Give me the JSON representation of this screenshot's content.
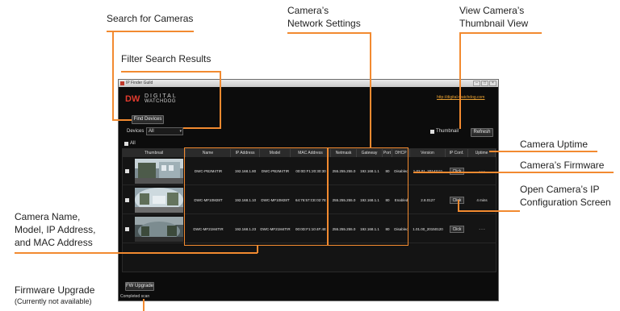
{
  "callouts": {
    "search_cameras": "Search for Cameras",
    "filter_results": "Filter Search Results",
    "network_settings_1": "Camera’s",
    "network_settings_2": "Network Settings",
    "thumbnail_view_1": "View Camera’s",
    "thumbnail_view_2": "Thumbnail View",
    "uptime": "Camera Uptime",
    "firmware": "Camera’s Firmware",
    "ip_config_1": "Open Camera’s IP",
    "ip_config_2": "Configuration Screen",
    "name_block_1": "Camera Name,",
    "name_block_2": "Model, IP Address,",
    "name_block_3": "and MAC Address",
    "fw_upgrade_1": "Firmware Upgrade",
    "fw_upgrade_2": "(Currently not available)"
  },
  "app": {
    "title": "IP Finder Guild",
    "logo_mark": "DW",
    "logo_brand": "DIGITAL",
    "logo_brand2": "WATCHDOG",
    "web_link": "http://digital-watchdog.com",
    "find_devices": "Find Devices",
    "devices_label": "Devices",
    "devices_value": "All",
    "thumbnail_label": "Thumbnail",
    "refresh": "Refresh",
    "all_label": "All",
    "fw_upgrade": "FW Upgrade",
    "status": "Completed scan"
  },
  "table": {
    "columns": [
      "Thumbnail",
      "Name",
      "IP Address",
      "Model",
      "MAC Address",
      "Netmask",
      "Gateway",
      "Port",
      "DHCP",
      "Version",
      "IP Conf.",
      "Uptime"
    ],
    "rows": [
      {
        "name": "DWC-PB2M4TIR",
        "ip": "192.168.1.80",
        "model": "DWC-PB2M4TIR",
        "mac": "00:0D:F1:20:30:30",
        "netmask": "255.255.255.0",
        "gateway": "192.168.1.1",
        "port": "80",
        "dhcp": "Disabled",
        "version": "1.02.01_20141111",
        "ipconf": "Click",
        "uptime": "- - -"
      },
      {
        "name": "DWC-MF10M28T",
        "ip": "192.168.1.10",
        "model": "DWC-MF10M28T",
        "mac": "64:76:57:CE:02:7E",
        "netmask": "255.255.255.0",
        "gateway": "192.168.1.1",
        "port": "80",
        "dhcp": "Enabled",
        "version": "2.8.0127",
        "ipconf": "Click",
        "uptime": "4 mins"
      },
      {
        "name": "DWC-MF21M4TIR",
        "ip": "192.168.1.23",
        "model": "DWC-MF21M4TIR",
        "mac": "00:0D:F1:10:4F:4E",
        "netmask": "255.255.255.0",
        "gateway": "192.168.1.1",
        "port": "80",
        "dhcp": "Disabled",
        "version": "1.01.00_20150120",
        "ipconf": "Click",
        "uptime": "- - -"
      }
    ]
  }
}
